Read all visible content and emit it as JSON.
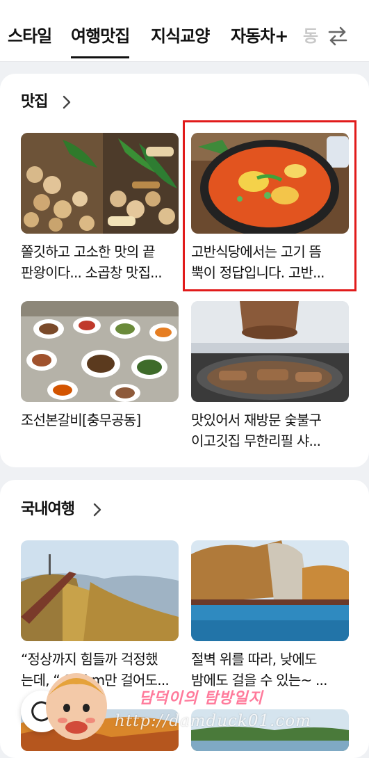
{
  "tabs": {
    "items": [
      {
        "label": "스타일"
      },
      {
        "label": "여행맛집"
      },
      {
        "label": "지식교양"
      },
      {
        "label": "자동차+"
      },
      {
        "label": "동"
      }
    ]
  },
  "sections": [
    {
      "title": "맛집",
      "items": [
        {
          "caption": "쫄깃하고 고소한 맛의 끝\n판왕이다... 소곱창 맛집..."
        },
        {
          "caption": "고반식당에서는 고기 뜸\n뿍이 정답입니다. 고반..."
        },
        {
          "caption": "조선본갈비[충무공동]"
        },
        {
          "caption": "맛있어서 재방문 숯불구\n이고깃집 무한리필 샤..."
        }
      ]
    },
    {
      "title": "국내여행",
      "items": [
        {
          "caption": "“정상까지 힘들까 걱정했\n는데, “ 0.5km만 걸어도..."
        },
        {
          "caption": "절벽 위를 따라, 낮에도\n밤에도 걸을 수 있는~ ..."
        }
      ]
    }
  ],
  "watermark": {
    "name": "담덕이의 탐방일지",
    "url": "http://damduck01.com"
  },
  "colors": {
    "highlight": "#e11b1b",
    "background": "#eff1f4"
  }
}
